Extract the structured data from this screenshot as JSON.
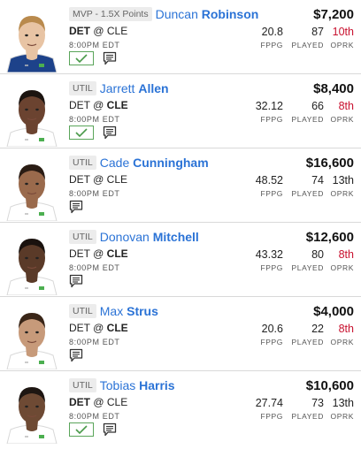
{
  "stat_labels": {
    "fppg": "FPPG",
    "played": "PLAYED",
    "oprk": "OPRK"
  },
  "players": [
    {
      "badge": "MVP - 1.5X Points",
      "first": "Duncan",
      "last": "Robinson",
      "salary": "$7,200",
      "team": "DET",
      "at": "@",
      "opp": "CLE",
      "bold": "team",
      "time": "8:00PM EDT",
      "fppg": "20.8",
      "played": "87",
      "oprk": "10th",
      "oprk_color": "#c8102e",
      "checked": true,
      "skin": "#e8c4a4",
      "hair": "#b98a4d",
      "jersey": "#1d428a"
    },
    {
      "badge": "UTIL",
      "first": "Jarrett",
      "last": "Allen",
      "salary": "$8,400",
      "team": "DET",
      "at": "@",
      "opp": "CLE",
      "bold": "opp",
      "time": "8:00PM EDT",
      "fppg": "32.12",
      "played": "66",
      "oprk": "8th",
      "oprk_color": "#c8102e",
      "checked": true,
      "skin": "#6b4330",
      "hair": "#1c1410",
      "jersey": "#ffffff"
    },
    {
      "badge": "UTIL",
      "first": "Cade",
      "last": "Cunningham",
      "salary": "$16,600",
      "team": "DET",
      "at": "@",
      "opp": "CLE",
      "bold": "none",
      "time": "8:00PM EDT",
      "fppg": "48.52",
      "played": "74",
      "oprk": "13th",
      "oprk_color": "#222222",
      "checked": false,
      "skin": "#9a6a4c",
      "hair": "#2a1c14",
      "jersey": "#ffffff"
    },
    {
      "badge": "UTIL",
      "first": "Donovan",
      "last": "Mitchell",
      "salary": "$12,600",
      "team": "DET",
      "at": "@",
      "opp": "CLE",
      "bold": "opp",
      "time": "8:00PM EDT",
      "fppg": "43.32",
      "played": "80",
      "oprk": "8th",
      "oprk_color": "#c8102e",
      "checked": false,
      "skin": "#5a3a28",
      "hair": "#1a120e",
      "jersey": "#ffffff"
    },
    {
      "badge": "UTIL",
      "first": "Max",
      "last": "Strus",
      "salary": "$4,000",
      "team": "DET",
      "at": "@",
      "opp": "CLE",
      "bold": "opp",
      "time": "8:00PM EDT",
      "fppg": "20.6",
      "played": "22",
      "oprk": "8th",
      "oprk_color": "#c8102e",
      "checked": false,
      "skin": "#c79a7a",
      "hair": "#3a2618",
      "jersey": "#ffffff"
    },
    {
      "badge": "UTIL",
      "first": "Tobias",
      "last": "Harris",
      "salary": "$10,600",
      "team": "DET",
      "at": "@",
      "opp": "CLE",
      "bold": "team",
      "time": "8:00PM EDT",
      "fppg": "27.74",
      "played": "73",
      "oprk": "13th",
      "oprk_color": "#222222",
      "checked": true,
      "skin": "#6e4a34",
      "hair": "#1e1612",
      "jersey": "#ffffff"
    }
  ]
}
